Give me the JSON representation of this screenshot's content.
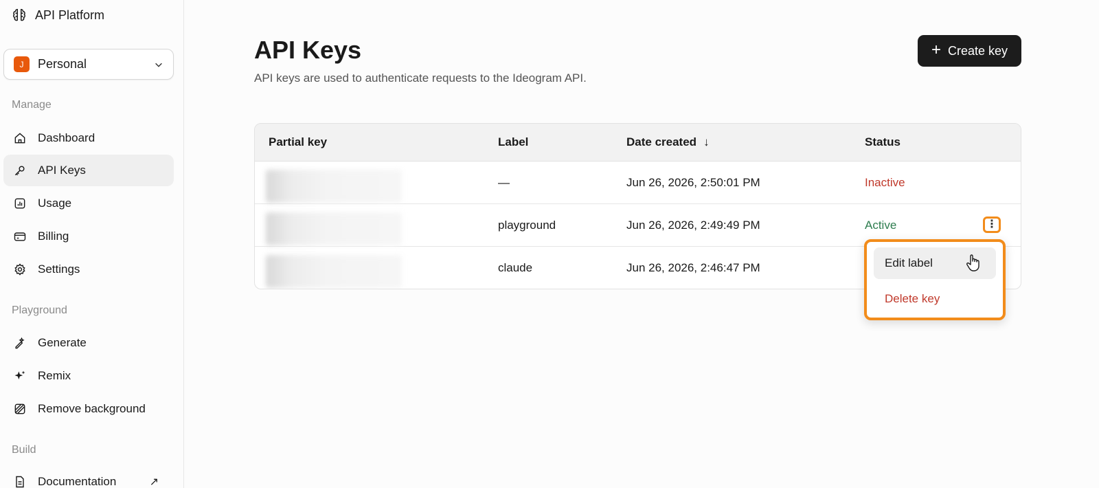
{
  "app": {
    "name": "API Platform"
  },
  "workspace": {
    "initial": "J",
    "name": "Personal"
  },
  "sidebar": {
    "sections": {
      "manage": "Manage",
      "playground": "Playground",
      "build": "Build"
    },
    "items": {
      "dashboard": "Dashboard",
      "api_keys": "API Keys",
      "usage": "Usage",
      "billing": "Billing",
      "settings": "Settings",
      "generate": "Generate",
      "remix": "Remix",
      "remove_background": "Remove background",
      "documentation": "Documentation"
    },
    "external_glyph": "↗"
  },
  "page": {
    "title": "API Keys",
    "description": "API keys are used to authenticate requests to the Ideogram API.",
    "create_button": "Create key",
    "create_icon": "+"
  },
  "table": {
    "columns": {
      "partial_key": "Partial key",
      "label": "Label",
      "date_created": "Date created",
      "status": "Status"
    },
    "sort_glyph": "↓",
    "rows": [
      {
        "label": "—",
        "date": "Jun 26, 2026, 2:50:01 PM",
        "status": "Inactive"
      },
      {
        "label": "playground",
        "date": "Jun 26, 2026, 2:49:49 PM",
        "status": "Active"
      },
      {
        "label": "claude",
        "date": "Jun 26, 2026, 2:46:47 PM",
        "status": ""
      }
    ]
  },
  "context_menu": {
    "edit": "Edit label",
    "delete": "Delete key"
  },
  "colors": {
    "accent_highlight": "#f28c1b",
    "danger": "#c0392b",
    "success": "#2e7d4f",
    "primary_button": "#1c1c1c",
    "avatar": "#e8590c"
  },
  "icons": {
    "brand": "brain-icon",
    "dashboard": "home-icon",
    "api_keys": "key-icon",
    "usage": "bar-chart-icon",
    "billing": "credit-card-icon",
    "settings": "gear-icon",
    "generate": "pen-sparkle-icon",
    "remix": "sparkles-icon",
    "remove_background": "square-slash-icon",
    "documentation": "document-icon"
  }
}
